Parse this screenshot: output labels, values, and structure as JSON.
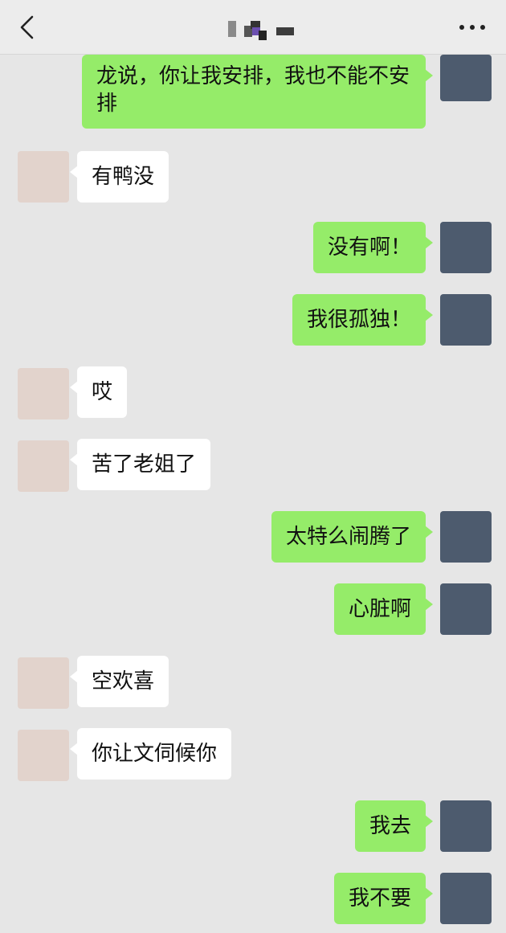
{
  "header": {
    "back_icon": "chevron-left-icon",
    "title": "",
    "more_icon": "more-dots-icon"
  },
  "messages": [
    {
      "side": "me",
      "text": "龙说，你让我安排，我也不能不安排"
    },
    {
      "side": "other",
      "text": "有鸭没"
    },
    {
      "side": "me",
      "text": "没有啊！"
    },
    {
      "side": "me",
      "text": "我很孤独！"
    },
    {
      "side": "other",
      "text": "哎"
    },
    {
      "side": "other",
      "text": "苦了老姐了"
    },
    {
      "side": "me",
      "text": "太特么闹腾了"
    },
    {
      "side": "me",
      "text": "心脏啊"
    },
    {
      "side": "other",
      "text": "空欢喜"
    },
    {
      "side": "other",
      "text": "你让文伺候你"
    },
    {
      "side": "me",
      "text": "我去"
    },
    {
      "side": "me",
      "text": "我不要"
    }
  ],
  "colors": {
    "background": "#e6e6e6",
    "bubble_me": "#95ec69",
    "bubble_other": "#ffffff",
    "header": "#ececec"
  }
}
